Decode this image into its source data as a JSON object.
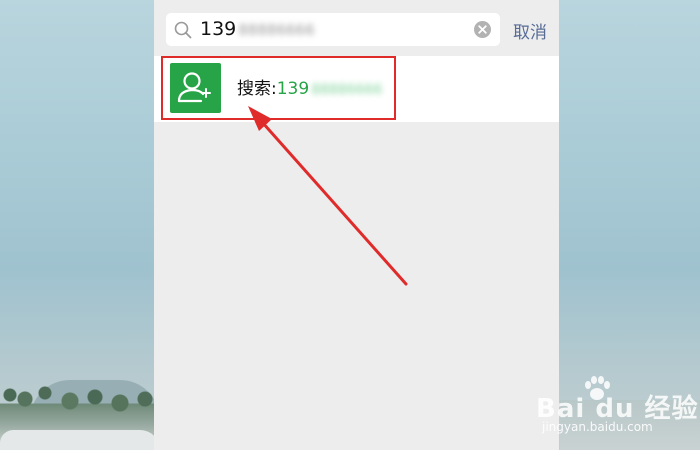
{
  "search": {
    "query_visible": "139",
    "query_blurred": "88886666",
    "cancel_label": "取消",
    "icon": "search-icon",
    "clear_icon": "clear-icon"
  },
  "result": {
    "prefix": "搜索:",
    "number_visible": "139",
    "number_blurred": "88886666",
    "icon": "add-friend-icon",
    "icon_color": "#27a447"
  },
  "annotation": {
    "highlight_color": "#e02b2b"
  },
  "watermark": {
    "brand": "Bai du 经验",
    "site": "jingyan.baidu.com"
  },
  "colors": {
    "accent_green": "#27a447",
    "link_blue": "#576b95",
    "panel_bg": "#ededed"
  }
}
